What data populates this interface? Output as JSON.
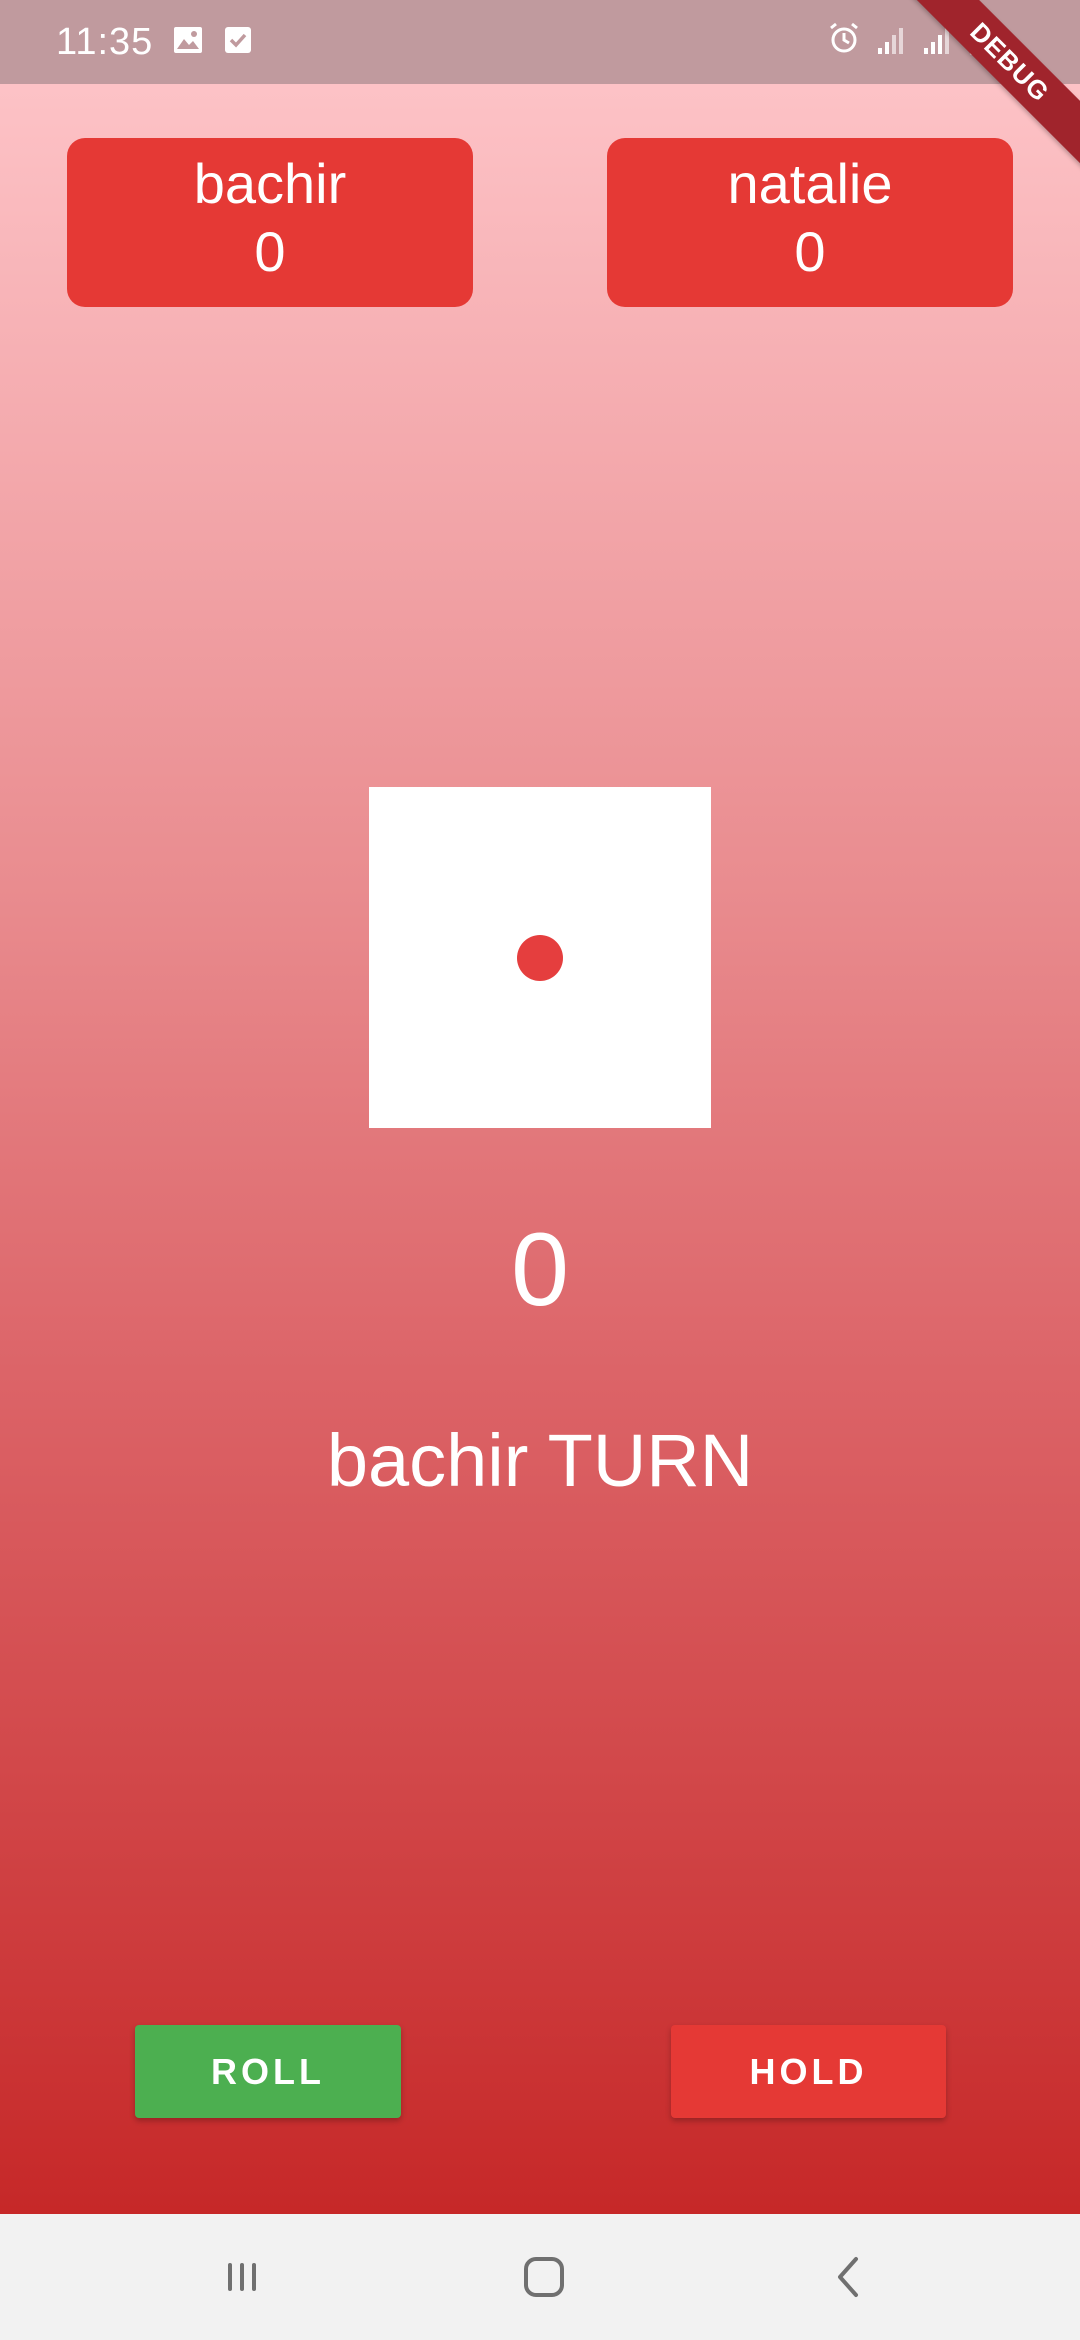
{
  "status_bar": {
    "time": "11:35",
    "left_icons": [
      "image-icon",
      "checkbox-icon"
    ],
    "right_icons": [
      "alarm-icon",
      "signal-icon",
      "signal-icon-2",
      "battery-icon"
    ]
  },
  "debug_banner": "DEBUG",
  "players": [
    {
      "name": "bachir",
      "score": "0"
    },
    {
      "name": "natalie",
      "score": "0"
    }
  ],
  "dice": {
    "value": 1
  },
  "current": {
    "round_score": "0",
    "turn_label": "bachir TURN"
  },
  "buttons": {
    "roll": "ROLL",
    "hold": "HOLD"
  },
  "nav": {
    "icons": [
      "recents-icon",
      "home-icon",
      "back-icon"
    ]
  },
  "colors": {
    "accent_red": "#e53935",
    "roll_green": "#4caf50",
    "pip_red": "#e53e3e"
  }
}
